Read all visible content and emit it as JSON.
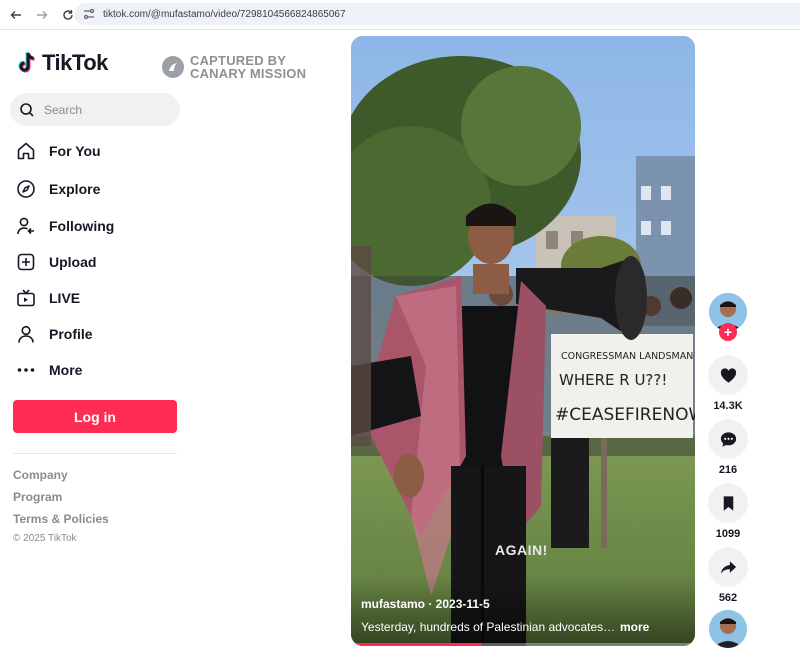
{
  "browser": {
    "url": "tiktok.com/@mufastamo/video/7298104566824865067"
  },
  "sidebar": {
    "logo_text": "TikTok",
    "search_placeholder": "Search",
    "nav": [
      {
        "label": "For You",
        "icon": "home-icon"
      },
      {
        "label": "Explore",
        "icon": "compass-icon"
      },
      {
        "label": "Following",
        "icon": "following-icon"
      },
      {
        "label": "Upload",
        "icon": "upload-icon"
      },
      {
        "label": "LIVE",
        "icon": "live-icon"
      },
      {
        "label": "Profile",
        "icon": "profile-icon"
      },
      {
        "label": "More",
        "icon": "more-icon"
      }
    ],
    "login_label": "Log in",
    "footer": {
      "company": "Company",
      "program": "Program",
      "terms": "Terms & Policies",
      "copyright": "© 2025 TikTok"
    }
  },
  "watermark": {
    "line1": "CAPTURED BY",
    "line2": "CANARY MISSION"
  },
  "video": {
    "author_date": "mufastamo · 2023-11-5",
    "description": "Yesterday, hundreds of Palestinian advocates ...",
    "more_label": "more",
    "overlay_text": "AGAIN!",
    "sign_line1": "CONGRESSMAN LANDSMAN",
    "sign_line2": "WHERE R U??!",
    "sign_line3": "#CEASEFIRENOW",
    "progress": 0.38
  },
  "actions": {
    "likes": "14.3K",
    "comments": "216",
    "saves": "1099",
    "shares": "562"
  },
  "colors": {
    "brand": "#fe2c55",
    "text": "#161823",
    "muted": "#8a8b91"
  }
}
